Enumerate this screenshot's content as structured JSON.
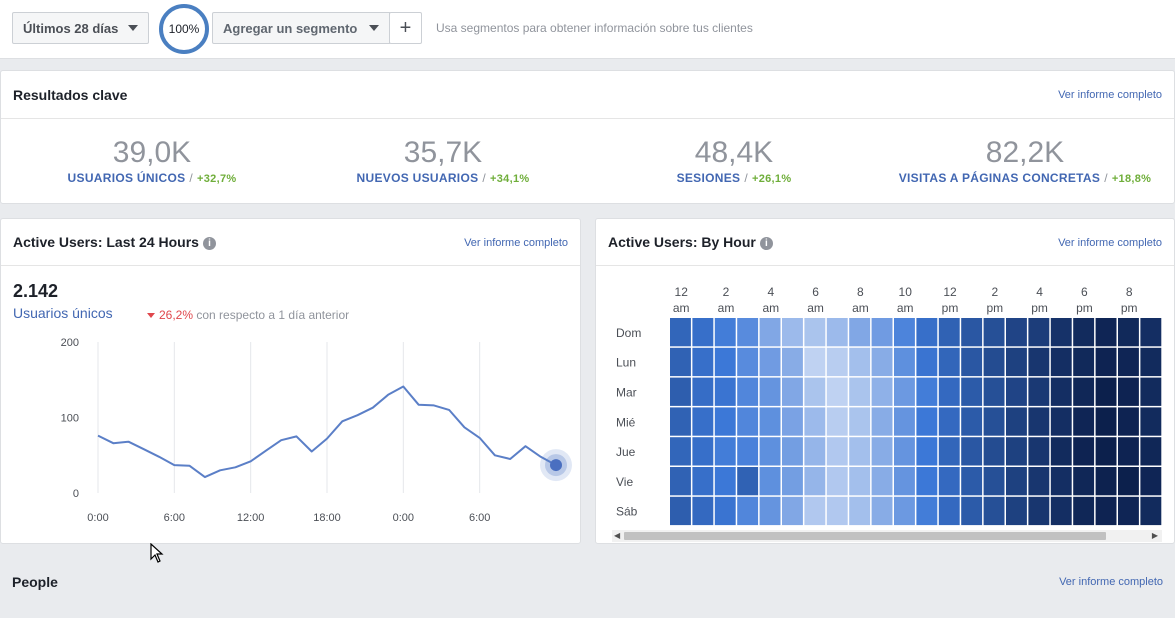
{
  "topbar": {
    "date_range": "Últimos 28 días",
    "percent": "100%",
    "segment_button": "Agregar un segmento",
    "plus": "+",
    "hint": "Usa segmentos para obtener información sobre tus clientes"
  },
  "key_results": {
    "title": "Resultados clave",
    "link": "Ver informe completo",
    "metrics": [
      {
        "value": "39,0K",
        "label": "USUARIOS ÚNICOS",
        "sep": "/",
        "change": "+32,7%"
      },
      {
        "value": "35,7K",
        "label": "NUEVOS USUARIOS",
        "sep": "/",
        "change": "+34,1%"
      },
      {
        "value": "48,4K",
        "label": "SESIONES",
        "sep": "/",
        "change": "+26,1%"
      },
      {
        "value": "82,2K",
        "label": "VISITAS A PÁGINAS CONCRETAS",
        "sep": "/",
        "change": "+18,8%"
      }
    ]
  },
  "active24": {
    "title": "Active Users: Last 24 Hours",
    "link": "Ver informe completo",
    "count": "2.142",
    "metric_label": "Usuarios únicos",
    "change": "26,2%",
    "change_text": "con respecto a 1 día anterior"
  },
  "byhour": {
    "title": "Active Users: By Hour",
    "link": "Ver informe completo"
  },
  "people": {
    "title": "People",
    "link": "Ver informe completo"
  },
  "colors": {
    "accent": "#4267b2",
    "positive": "#6fae3a",
    "negative": "#e0474c",
    "line": "#5b7fc7"
  },
  "chart_data": [
    {
      "type": "line",
      "title": "Active Users: Last 24 Hours",
      "y_ticks": [
        "200",
        "100",
        "0"
      ],
      "ylim": [
        0,
        200
      ],
      "x_ticks": [
        "0:00",
        "6:00",
        "12:00",
        "18:00",
        "0:00",
        "6:00"
      ],
      "xlim": [
        0,
        30
      ],
      "x": [
        0,
        1,
        2,
        3,
        4,
        5,
        6,
        7,
        8,
        9,
        10,
        11,
        12,
        13,
        14,
        15,
        16,
        17,
        18,
        19,
        20,
        21,
        22,
        23,
        24,
        25,
        26,
        27,
        28,
        29,
        30
      ],
      "values": [
        76,
        66,
        68,
        58,
        48,
        37,
        36,
        21,
        30,
        34,
        42,
        56,
        70,
        75,
        55,
        72,
        95,
        103,
        113,
        130,
        141,
        117,
        116,
        110,
        87,
        73,
        50,
        45,
        62,
        48,
        37
      ],
      "grid": true
    },
    {
      "type": "heatmap",
      "title": "Active Users: By Hour",
      "x_labels_top": [
        "12",
        "2",
        "4",
        "6",
        "8",
        "10",
        "12",
        "2",
        "4",
        "6",
        "8"
      ],
      "x_labels_bottom": [
        "am",
        "am",
        "am",
        "am",
        "am",
        "am",
        "pm",
        "pm",
        "pm",
        "pm",
        "pm"
      ],
      "y_labels": [
        "Dom",
        "Lun",
        "Mar",
        "Mié",
        "Jue",
        "Vie",
        "Sáb"
      ],
      "values": [
        [
          0.6,
          0.55,
          0.48,
          0.42,
          0.3,
          0.22,
          0.18,
          0.22,
          0.3,
          0.35,
          0.45,
          0.55,
          0.62,
          0.68,
          0.72,
          0.78,
          0.82,
          0.88,
          0.92,
          0.95,
          0.93,
          0.9
        ],
        [
          0.62,
          0.55,
          0.5,
          0.42,
          0.35,
          0.28,
          0.12,
          0.14,
          0.2,
          0.28,
          0.4,
          0.52,
          0.6,
          0.68,
          0.74,
          0.8,
          0.86,
          0.9,
          0.93,
          0.96,
          0.95,
          0.92
        ],
        [
          0.64,
          0.56,
          0.52,
          0.44,
          0.38,
          0.3,
          0.18,
          0.12,
          0.18,
          0.26,
          0.36,
          0.48,
          0.58,
          0.66,
          0.72,
          0.78,
          0.84,
          0.9,
          0.94,
          0.98,
          0.96,
          0.92
        ],
        [
          0.62,
          0.55,
          0.5,
          0.44,
          0.4,
          0.32,
          0.22,
          0.14,
          0.18,
          0.28,
          0.38,
          0.5,
          0.58,
          0.66,
          0.72,
          0.8,
          0.86,
          0.9,
          0.95,
          0.98,
          0.96,
          0.92
        ],
        [
          0.6,
          0.55,
          0.48,
          0.46,
          0.4,
          0.34,
          0.24,
          0.16,
          0.2,
          0.28,
          0.38,
          0.5,
          0.6,
          0.68,
          0.74,
          0.8,
          0.86,
          0.92,
          0.96,
          0.98,
          0.96,
          0.94
        ],
        [
          0.62,
          0.55,
          0.5,
          0.62,
          0.4,
          0.34,
          0.24,
          0.16,
          0.2,
          0.28,
          0.38,
          0.5,
          0.58,
          0.66,
          0.72,
          0.8,
          0.86,
          0.9,
          0.94,
          0.97,
          0.98,
          0.95
        ],
        [
          0.64,
          0.58,
          0.52,
          0.44,
          0.38,
          0.3,
          0.16,
          0.16,
          0.2,
          0.28,
          0.36,
          0.48,
          0.58,
          0.66,
          0.72,
          0.8,
          0.86,
          0.9,
          0.94,
          0.96,
          0.95,
          0.92
        ]
      ]
    }
  ]
}
